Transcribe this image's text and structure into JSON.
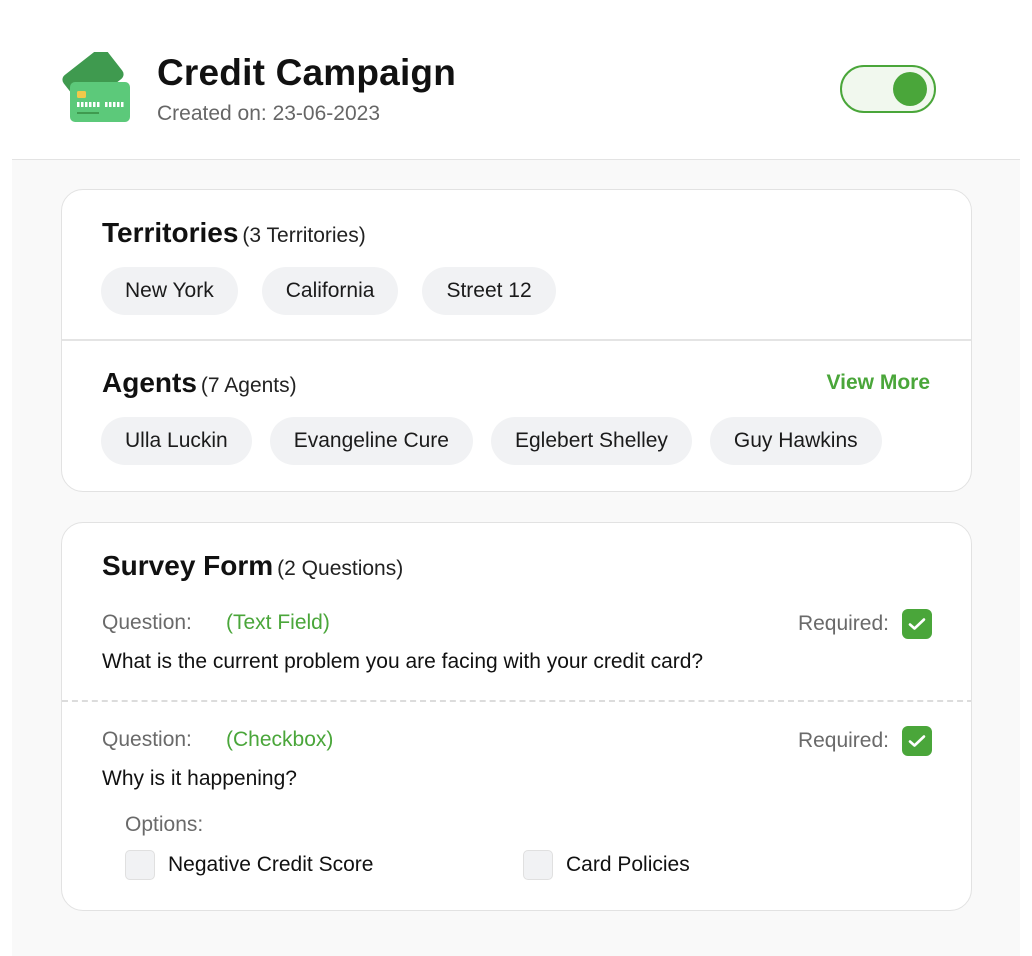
{
  "colors": {
    "accent": "#4aa63a",
    "chip_background": "#f1f2f4",
    "muted_text": "#6a6a6a"
  },
  "header": {
    "icon": "credit-card-icon",
    "title": "Credit Campaign",
    "created_on": "Created on: 23-06-2023",
    "toggle": {
      "state": "on"
    }
  },
  "territories": {
    "title": "Territories",
    "count": "(3 Territories)",
    "items": [
      "New York",
      "California",
      "Street 12"
    ]
  },
  "agents": {
    "title": "Agents",
    "count": "(7 Agents)",
    "view_more": "View More",
    "items": [
      "Ulla Luckin",
      "Evangeline Cure",
      "Eglebert Shelley",
      "Guy Hawkins"
    ]
  },
  "survey": {
    "title": "Survey Form",
    "count": "(2 Questions)",
    "questions": [
      {
        "label": "Question:",
        "type": "(Text Field)",
        "required_label": "Required:",
        "required": true,
        "text": "What is the current problem you are facing with your credit card?"
      },
      {
        "label": "Question:",
        "type": "(Checkbox)",
        "required_label": "Required:",
        "required": true,
        "text": "Why is it happening?",
        "options_label": "Options:",
        "options": [
          {
            "label": "Negative Credit Score",
            "checked": false
          },
          {
            "label": "Card Policies",
            "checked": false
          }
        ]
      }
    ]
  }
}
